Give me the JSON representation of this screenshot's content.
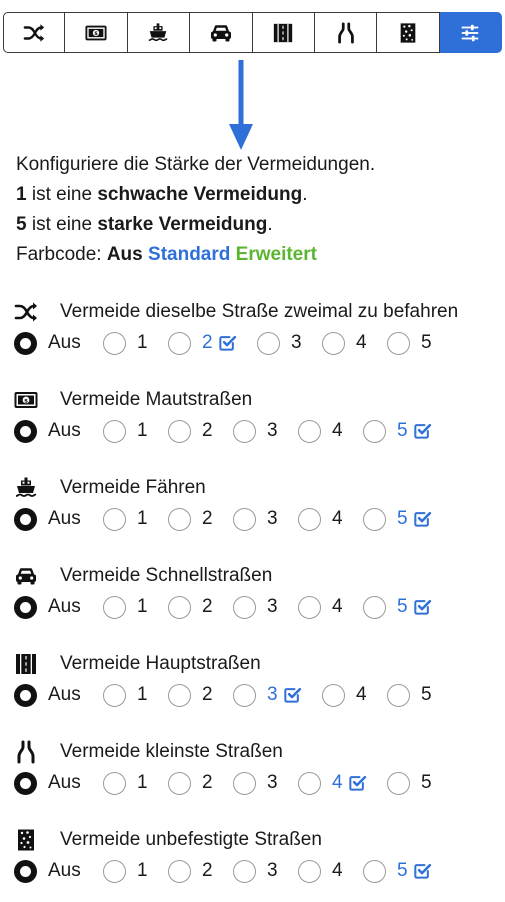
{
  "tabs": [
    {
      "icon": "shuffle-icon",
      "name": "tab-same-road"
    },
    {
      "icon": "banknote-icon",
      "name": "tab-toll-roads"
    },
    {
      "icon": "ferry-icon",
      "name": "tab-ferries"
    },
    {
      "icon": "car-icon",
      "name": "tab-highways"
    },
    {
      "icon": "road-icon",
      "name": "tab-main-roads"
    },
    {
      "icon": "narrow-road-icon",
      "name": "tab-small-roads"
    },
    {
      "icon": "unpaved-road-icon",
      "name": "tab-unpaved-roads"
    },
    {
      "icon": "sliders-icon",
      "name": "tab-settings",
      "active": true
    }
  ],
  "intro": {
    "line1": "Konfiguriere die Stärke der Vermeidungen.",
    "line2_num": "1",
    "line2_mid": " ist eine ",
    "line2_bold": "schwache Vermeidung",
    "line2_end": ".",
    "line3_num": "5",
    "line3_mid": " ist eine ",
    "line3_bold": "starke Vermeidung",
    "line3_end": ".",
    "line4_label": "Farbcode: ",
    "line4_aus": "Aus",
    "line4_standard": "Standard",
    "line4_erweitert": "Erweitert"
  },
  "option_labels": [
    "Aus",
    "1",
    "2",
    "3",
    "4",
    "5"
  ],
  "sections": [
    {
      "icon": "shuffle-icon",
      "title": "Vermeide dieselbe Straße zweimal zu befahren",
      "selected": "Aus",
      "default": "2"
    },
    {
      "icon": "banknote-icon",
      "title": "Vermeide Mautstraßen",
      "selected": "Aus",
      "default": "5"
    },
    {
      "icon": "ferry-icon",
      "title": "Vermeide Fähren",
      "selected": "Aus",
      "default": "5"
    },
    {
      "icon": "car-icon",
      "title": "Vermeide Schnellstraßen",
      "selected": "Aus",
      "default": "5"
    },
    {
      "icon": "road-icon",
      "title": "Vermeide Hauptstraßen",
      "selected": "Aus",
      "default": "3"
    },
    {
      "icon": "narrow-road-icon",
      "title": "Vermeide kleinste Straßen",
      "selected": "Aus",
      "default": "4"
    },
    {
      "icon": "unpaved-road-icon",
      "title": "Vermeide unbefestigte Straßen",
      "selected": "Aus",
      "default": "5"
    }
  ],
  "colors": {
    "accent": "#2f6fd8",
    "extended": "#5cb531",
    "text": "#1a1a1a"
  }
}
